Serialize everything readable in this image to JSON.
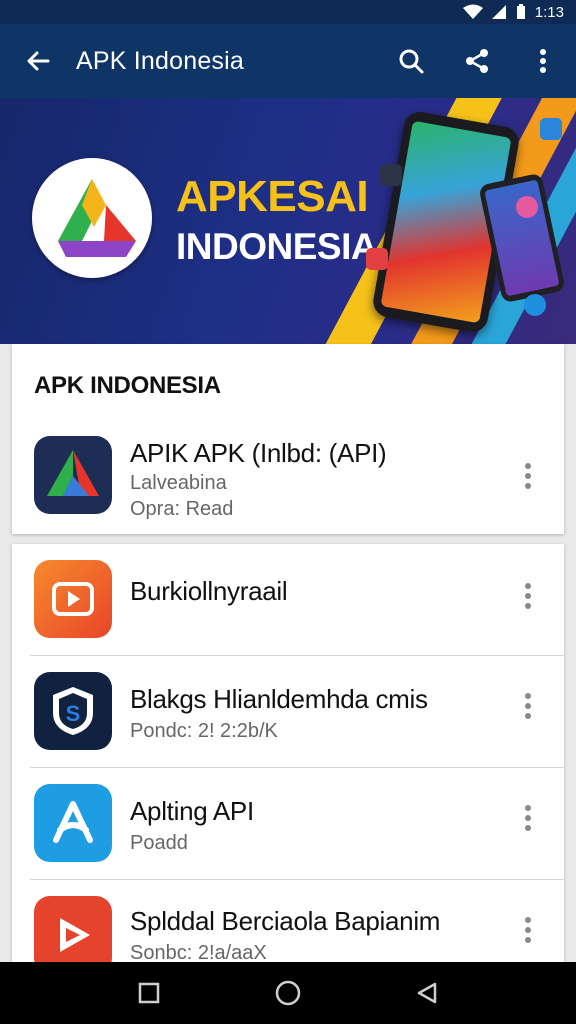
{
  "status_bar": {
    "time": "1:13"
  },
  "app_bar": {
    "title": "APK Indonesia"
  },
  "banner": {
    "line1": "APKESAI",
    "line2": "INDONESIA"
  },
  "featured": {
    "section_title": "APK INDONESIA",
    "app": {
      "name": "APIK APK (Inlbd: (API)",
      "line1": "Lalveabina",
      "line2": "Opra: Read"
    }
  },
  "list": [
    {
      "name": "Burkiollnyraail",
      "sub": "",
      "icon": "play-icon",
      "color": "#ef6a2b"
    },
    {
      "name": "Blakgs Hlianldemhda cmis",
      "sub": "Pondc: 2! 2:2b/K",
      "icon": "shield-s-icon",
      "color": "#0f2544"
    },
    {
      "name": "Aplting API",
      "sub": "Poadd",
      "icon": "a-logo-icon",
      "color": "#1e9de3"
    },
    {
      "name": "Splddal Berciaola Bapianim",
      "sub": "Sonbc: 2!a/aaX",
      "icon": "play-arrow-red-icon",
      "color": "#e6432c"
    }
  ],
  "colors": {
    "app_bar": "#0f3466",
    "status_bar": "#0e2a55",
    "accent_yellow": "#f6c21a"
  }
}
